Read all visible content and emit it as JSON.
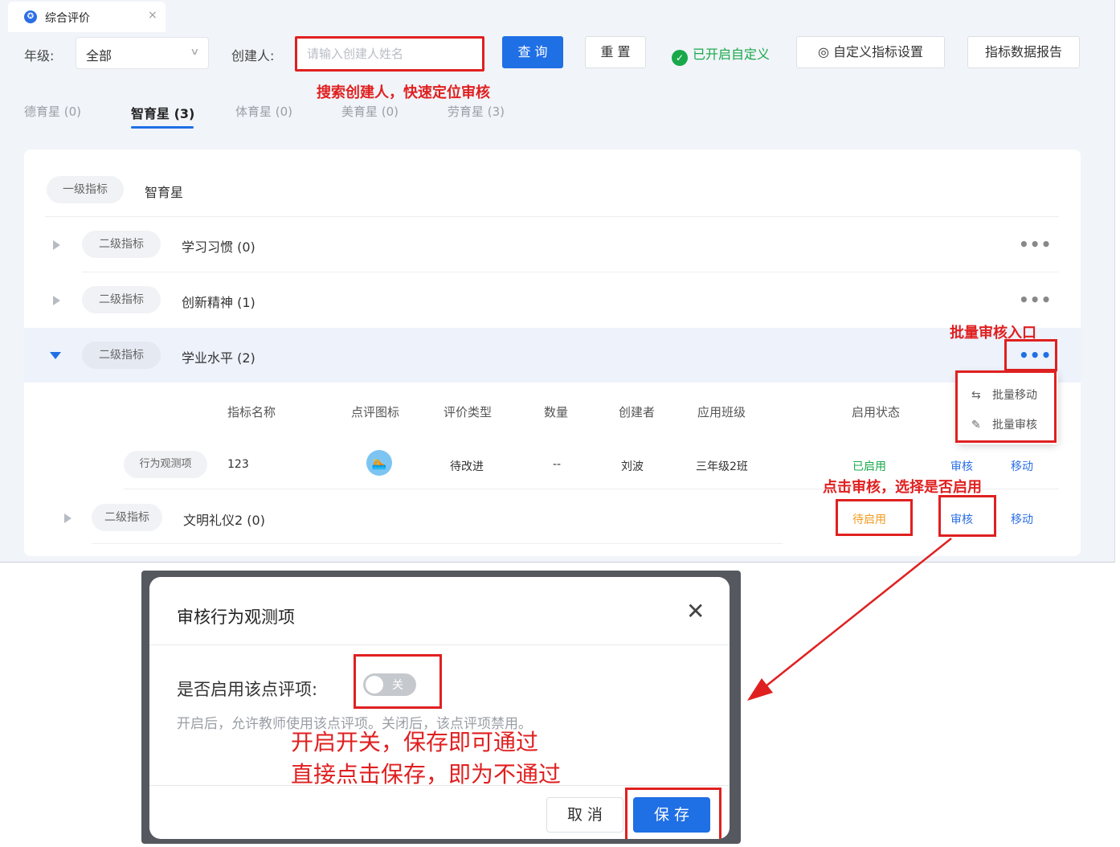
{
  "tab": {
    "title": "综合评价",
    "close": "×"
  },
  "filters": {
    "grade_label": "年级:",
    "grade_value": "全部",
    "creator_label": "创建人:",
    "creator_placeholder": "请输入创建人姓名",
    "query": "查 询",
    "reset": "重 置",
    "custom_enabled": "已开启自定义",
    "custom_settings": "自定义指标设置",
    "report": "指标数据报告"
  },
  "annotations": {
    "search": "搜索创建人，快速定位审核",
    "batch_entry": "批量审核入口",
    "click_review": "点击审核，选择是否启用",
    "dialog_line1": "开启开关，保存即可通过",
    "dialog_line2": "直接点击保存，即为不通过"
  },
  "star_tabs": [
    {
      "label": "德育星 (0)"
    },
    {
      "label": "智育星 (3)"
    },
    {
      "label": "体育星 (0)"
    },
    {
      "label": "美育星 (0)"
    },
    {
      "label": "劳育星 (3)"
    }
  ],
  "level1": {
    "tag": "一级指标",
    "name": "智育星"
  },
  "level2": [
    {
      "tag": "二级指标",
      "name": "学习习惯 (0)"
    },
    {
      "tag": "二级指标",
      "name": "创新精神 (1)"
    },
    {
      "tag": "二级指标",
      "name": "学业水平 (2)"
    },
    {
      "tag": "二级指标",
      "name": "文明礼仪2 (0)"
    }
  ],
  "more": "•••",
  "table": {
    "headers": [
      "指标名称",
      "点评图标",
      "评价类型",
      "数量",
      "创建者",
      "应用班级",
      "启用状态"
    ],
    "row": {
      "tag": "行为观测项",
      "name": "123",
      "type": "待改进",
      "count": "--",
      "creator": "刘波",
      "class": "三年级2班",
      "status": "已启用",
      "review": "审核",
      "move": "移动"
    },
    "row2": {
      "status": "待启用",
      "review": "审核",
      "move": "移动"
    }
  },
  "batch_menu": {
    "move": "批量移动",
    "review": "批量审核"
  },
  "dialog": {
    "title": "审核行为观测项",
    "enable_label": "是否启用该点评项:",
    "toggle_text": "关",
    "hint": "开启后，允许教师使用该点评项。关闭后，该点评项禁用。",
    "cancel": "取 消",
    "save": "保 存"
  },
  "colors": {
    "accent": "#1f6fe5",
    "annotation": "#e02020",
    "success": "#18a84a",
    "warning": "#f29b1d"
  }
}
